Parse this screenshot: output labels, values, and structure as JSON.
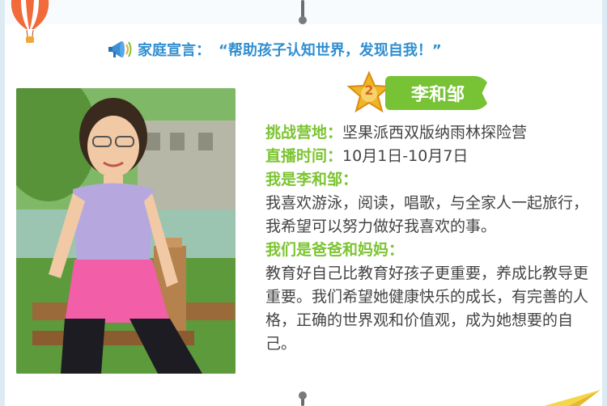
{
  "colors": {
    "accent_green": "#7cc431",
    "accent_blue": "#2f8ed0",
    "text": "#444444",
    "badge_gold": "#f0b429"
  },
  "header": {
    "motto_label": "家庭宣言：",
    "motto_text": "“帮助孩子认知世界，发现自我！”"
  },
  "profile": {
    "rank": "2",
    "name": "李和邹",
    "camp_label": "挑战营地：",
    "camp_value": "坚果派西双版纳雨林探险营",
    "live_label": "直播时间：",
    "live_value": "10月1日-10月7日",
    "intro_label": "我是李和邹：",
    "intro_text": "我喜欢游泳，阅读，唱歌，与全家人一起旅行，我希望可以努力做好我喜欢的事。",
    "parents_label": "我们是爸爸和妈妈：",
    "parents_text": "教育好自己比教育好孩子更重要，养成比教导更重要。我们希望她健康快乐的成长，有完善的人格，正确的世界观和价值观，成为她想要的自己。"
  },
  "icons": [
    "megaphone-icon",
    "hot-air-balloon-icon",
    "paper-plane-icon",
    "star-badge-icon"
  ]
}
